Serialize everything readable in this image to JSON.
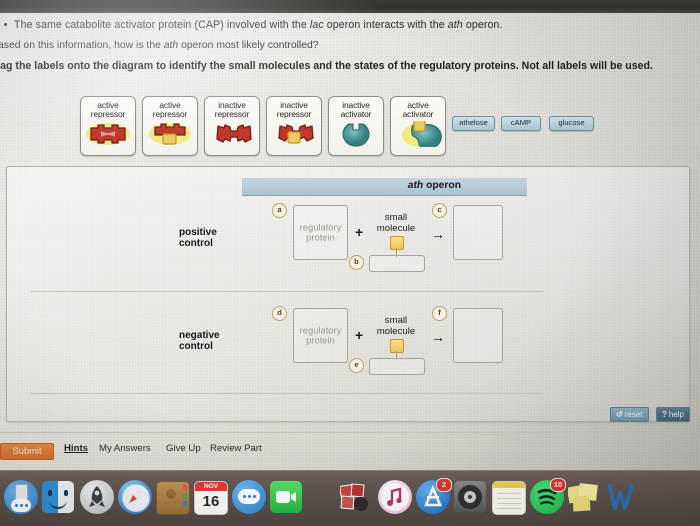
{
  "question": {
    "bullet": "The same catabolite activator protein (CAP) involved with the lac operon interacts with the ath operon.",
    "bullet_parts": [
      "The same catabolite activator protein (CAP) involved with the ",
      "lac",
      " operon interacts with the ",
      "ath",
      " operon."
    ],
    "prompt_parts": [
      "ased on this information, how is the ",
      "ath",
      " operon most likely controlled?"
    ],
    "instruction": "rag the labels onto the diagram to identify the small molecules and the states of the regulatory proteins. Not all labels will be used."
  },
  "label_bank": {
    "cards": [
      {
        "line1": "active",
        "line2": "repressor",
        "shape": "repressor-straight",
        "glow": true,
        "bound_molecule": false
      },
      {
        "line1": "active",
        "line2": "repressor",
        "shape": "repressor-straight",
        "glow": true,
        "bound_molecule": true
      },
      {
        "line1": "inactive",
        "line2": "repressor",
        "shape": "repressor-bent",
        "glow": false,
        "bound_molecule": false
      },
      {
        "line1": "inactive",
        "line2": "repressor",
        "shape": "repressor-bent",
        "glow": false,
        "bound_molecule": true
      },
      {
        "line1": "inactive",
        "line2": "activator",
        "shape": "activator-blob",
        "glow": false,
        "bound_molecule": false
      },
      {
        "line1": "active",
        "line2": "activator",
        "shape": "activator-blob",
        "glow": true,
        "bound_molecule": true
      }
    ],
    "molecules": [
      "athelose",
      "cAMP",
      "glucose"
    ]
  },
  "diagram": {
    "operon_title_italic": "ath",
    "operon_title_rest": " operon",
    "rows": [
      {
        "label_line1": "positive",
        "label_line2": "control",
        "protein_tag": "a",
        "protein_placeholder_line1": "regulatory",
        "protein_placeholder_line2": "protein",
        "plus": "+",
        "molecule_tag": "b",
        "molecule_label_line1": "small",
        "molecule_label_line2": "molecule",
        "arrow": "→",
        "product_tag": "c"
      },
      {
        "label_line1": "negative",
        "label_line2": "control",
        "protein_tag": "d",
        "protein_placeholder_line1": "regulatory",
        "protein_placeholder_line2": "protein",
        "plus": "+",
        "molecule_tag": "e",
        "molecule_label_line1": "small",
        "molecule_label_line2": "molecule",
        "arrow": "→",
        "product_tag": "f"
      }
    ]
  },
  "tools": {
    "reset_label": "reset",
    "reset_icon": "↺",
    "help_label": "help",
    "help_icon": "?"
  },
  "footer": {
    "submit": "Submit",
    "links": [
      "Hints",
      "My Answers",
      "Give Up",
      "Review Part"
    ]
  },
  "dock": {
    "items": [
      {
        "name": "messages-blue-icon",
        "badge": ""
      },
      {
        "name": "finder-icon",
        "badge": ""
      },
      {
        "name": "launchpad-icon",
        "badge": ""
      },
      {
        "name": "safari-icon",
        "badge": ""
      },
      {
        "name": "contacts-icon",
        "badge": ""
      },
      {
        "name": "calendar-icon",
        "badge": "",
        "month": "NOV",
        "day": "16"
      },
      {
        "name": "messages-icon",
        "badge": ""
      },
      {
        "name": "facetime-icon",
        "badge": ""
      },
      {
        "name": "photo-booth-icon",
        "badge": ""
      },
      {
        "name": "itunes-icon",
        "badge": ""
      },
      {
        "name": "app-store-icon",
        "badge": "2"
      },
      {
        "name": "system-preferences-icon",
        "badge": ""
      },
      {
        "name": "notes-icon",
        "badge": ""
      },
      {
        "name": "spotify-icon",
        "badge": "10"
      },
      {
        "name": "stickies-icon",
        "badge": ""
      },
      {
        "name": "word-icon",
        "badge": ""
      }
    ]
  },
  "colors": {
    "repressor_red": "#c0392b",
    "activator_teal": "#3f8f90",
    "molecule_yellow": "#edc95f",
    "accent_orange": "#d4762f",
    "operon_bar": "#b4cbd5"
  }
}
